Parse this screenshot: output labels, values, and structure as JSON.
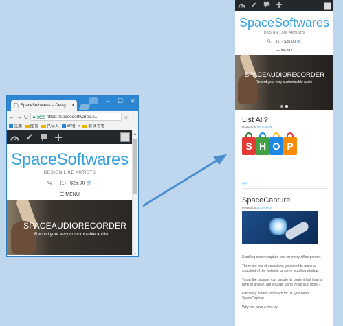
{
  "browser": {
    "tab_title": "SpaceSoftwares – Desig",
    "url_secure_label": "安全",
    "url": "https://spacesoftwares.c...",
    "bookmarks": [
      {
        "icon": "apps-icon",
        "label": "应用"
      },
      {
        "icon": "folder-icon",
        "label": "图查"
      },
      {
        "icon": "folder-icon",
        "label": "已导入"
      },
      {
        "icon": "bing-icon",
        "label": "Bing"
      },
      {
        "icon": "more-icon",
        "label": "»"
      },
      {
        "icon": "folder-icon",
        "label": "其他书签"
      }
    ]
  },
  "site": {
    "title": "SpaceSoftwares",
    "tagline": "DESIGN LIKE ARTISTS",
    "cart_text": "(1) - $25.00",
    "menu_label": "MENU",
    "hero_title": "SPACEAUDIORECORDER",
    "hero_subtitle": "Record your very customizable audio"
  },
  "posts": [
    {
      "title": "List All?",
      "meta_prefix": "Posted on",
      "date": "2018-06-05",
      "link": "###",
      "shop_letters": [
        "S",
        "H",
        "O",
        "P"
      ]
    },
    {
      "title": "SpaceCapture",
      "meta_prefix": "Posted on",
      "date": "2018-06-04",
      "paragraphs": [
        "Scrolling screen capture tool for every office person.",
        "There are lots of occasions, you need to make a snapshot of the website, or some scrolling window.",
        "Today the browser can update its content fast than a blink of an eye, are you still using those slug tools ?",
        "Efficiency means too much for us, you need SpaceCapture.",
        "Why not have a free try."
      ]
    }
  ],
  "colors": {
    "background": "#bfd7ee",
    "accent": "#35a2dd",
    "adminbar": "#23282d",
    "browser_frame": "#2b87d3",
    "arrow": "#4a8ed0"
  }
}
